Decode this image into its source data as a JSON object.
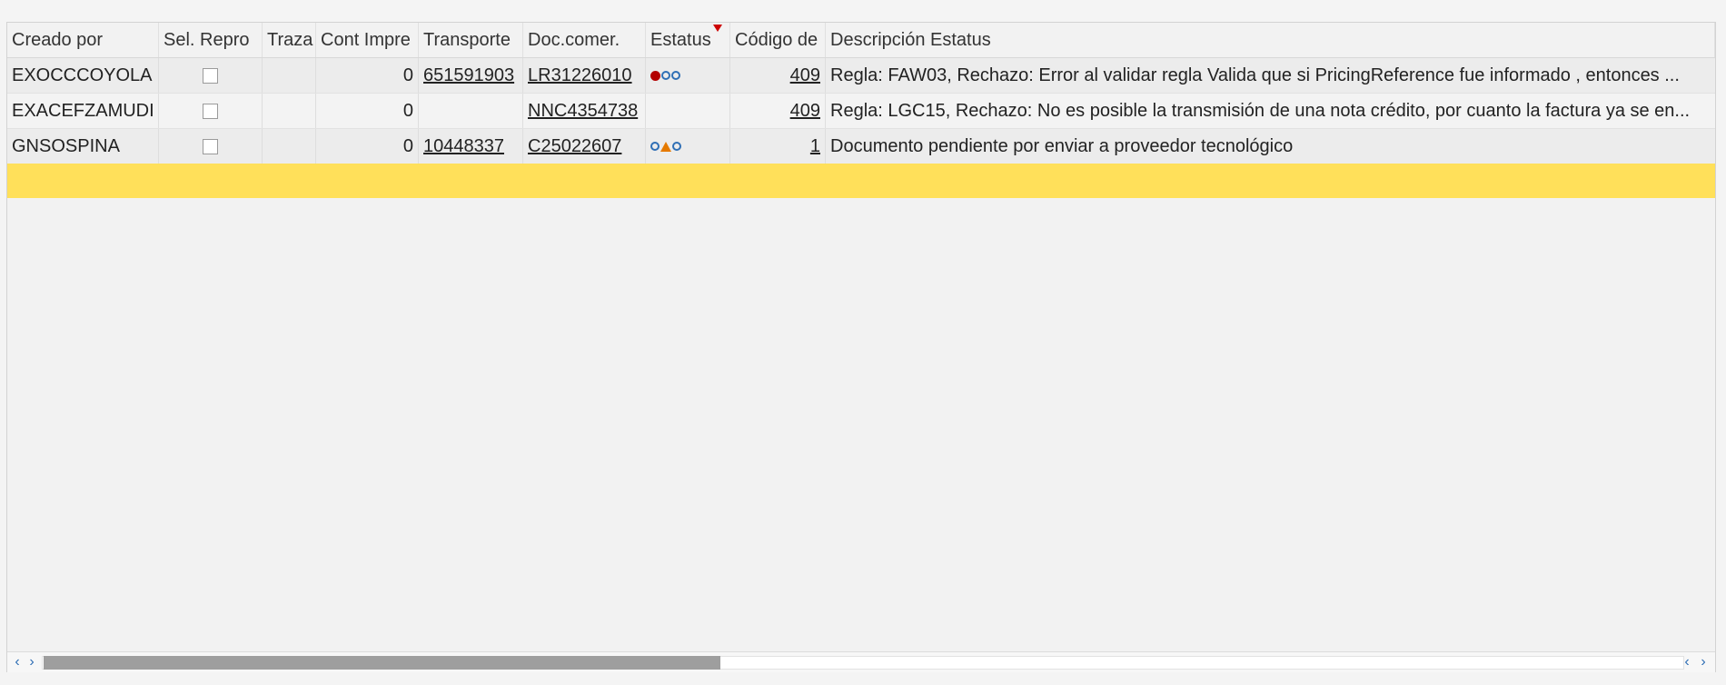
{
  "table": {
    "headers": {
      "creado": "Creado por",
      "sel": "Sel. Repro",
      "traza": "Traza",
      "cont": "Cont Impre",
      "trans": "Transporte",
      "doc": "Doc.comer.",
      "est": "Estatus",
      "cod": "Código de",
      "desc": "Descripción Estatus"
    },
    "rows": [
      {
        "creado": "EXOCCCOYOLA",
        "cont": "0",
        "trans": "651591903",
        "doc": "LR31226010",
        "status_icons": [
          "red-dot-icon",
          "blue-ring-icon",
          "blue-ring-icon"
        ],
        "cod": "409",
        "desc": "Regla: FAW03, Rechazo: Error al validar regla Valida que si PricingReference fue informado , entonces ..."
      },
      {
        "creado": "EXACEFZAMUDI",
        "cont": "0",
        "trans": "",
        "doc": "NNC4354738",
        "status_icons": [],
        "cod": "409",
        "desc": "Regla: LGC15, Rechazo: No es posible la transmisión de una nota crédito, por cuanto la factura ya se en..."
      },
      {
        "creado": "GNSOSPINA",
        "cont": "0",
        "trans": "10448337",
        "doc": "C25022607",
        "status_icons": [
          "blue-ring-icon",
          "orange-triangle-icon",
          "blue-ring-icon"
        ],
        "cod": "1",
        "desc": "Documento pendiente por enviar a proveedor tecnológico"
      }
    ]
  },
  "scroll": {
    "left_arrows": "‹ ›",
    "right_arrows": "‹ ›",
    "thumb_fraction": 0.41
  },
  "colors": {
    "selection": "#ffe05a",
    "status_red": "#b30000",
    "status_blue": "#2f6fb5",
    "status_orange": "#e57a00",
    "sort_indicator": "#cc0000"
  }
}
